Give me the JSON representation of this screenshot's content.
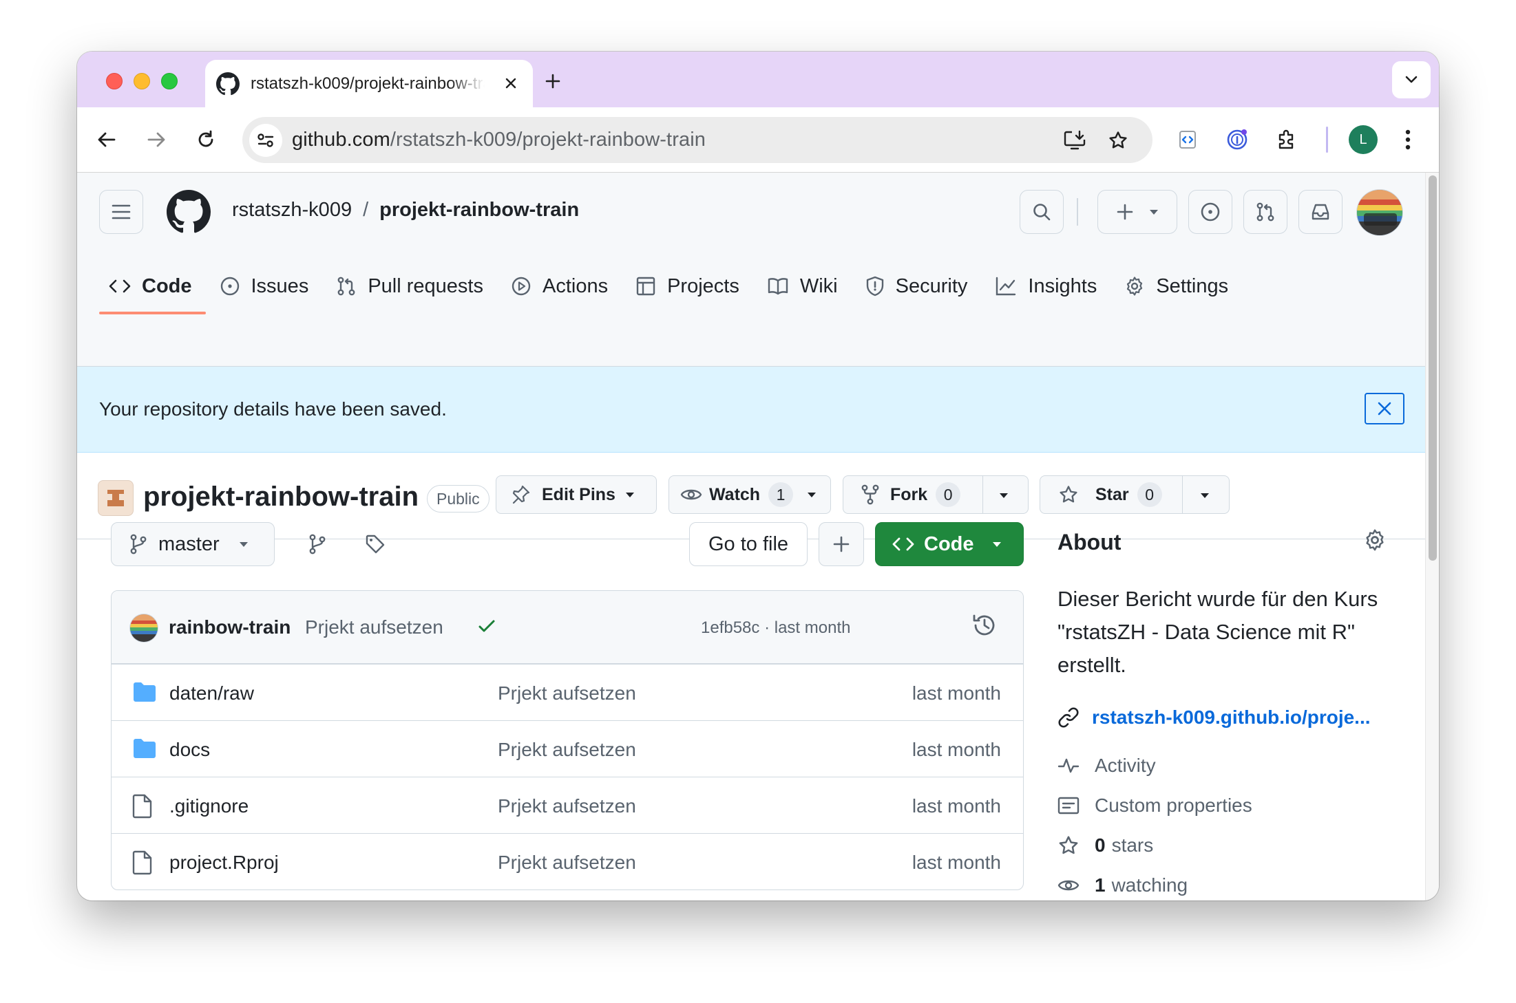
{
  "browser": {
    "tab_title": "rstatszh-k009/projekt-rainbow-train",
    "url_host": "github.com",
    "url_path": "/rstatszh-k009/projekt-rainbow-train",
    "profile_initial": "L"
  },
  "header": {
    "owner": "rstatszh-k009",
    "separator": "/",
    "repo": "projekt-rainbow-train"
  },
  "repo_nav": [
    {
      "label": "Code",
      "icon": "code-icon",
      "active": true
    },
    {
      "label": "Issues",
      "icon": "issue-icon"
    },
    {
      "label": "Pull requests",
      "icon": "pull-request-icon"
    },
    {
      "label": "Actions",
      "icon": "play-icon"
    },
    {
      "label": "Projects",
      "icon": "table-icon"
    },
    {
      "label": "Wiki",
      "icon": "book-icon"
    },
    {
      "label": "Security",
      "icon": "shield-icon"
    },
    {
      "label": "Insights",
      "icon": "graph-icon"
    },
    {
      "label": "Settings",
      "icon": "gear-icon"
    }
  ],
  "flash": {
    "message": "Your repository details have been saved."
  },
  "repo_title": {
    "name": "projekt-rainbow-train",
    "visibility": "Public",
    "edit_pins": "Edit Pins",
    "watch": "Watch",
    "watch_count": "1",
    "fork": "Fork",
    "fork_count": "0",
    "star": "Star",
    "star_count": "0"
  },
  "toolbar": {
    "branch": "master",
    "go_to_file": "Go to file",
    "code": "Code"
  },
  "latest_commit": {
    "author": "rainbow-train",
    "message": "Prjekt aufsetzen",
    "meta": "1efb58c · last month"
  },
  "files": [
    {
      "name": "daten/raw",
      "type": "folder",
      "message": "Prjekt aufsetzen",
      "date": "last month"
    },
    {
      "name": "docs",
      "type": "folder",
      "message": "Prjekt aufsetzen",
      "date": "last month"
    },
    {
      "name": ".gitignore",
      "type": "file",
      "message": "Prjekt aufsetzen",
      "date": "last month"
    },
    {
      "name": "project.Rproj",
      "type": "file",
      "message": "Prjekt aufsetzen",
      "date": "last month"
    }
  ],
  "about": {
    "heading": "About",
    "description": "Dieser Bericht wurde für den Kurs \"rstatsZH - Data Science mit R\" erstellt.",
    "link": "rstatszh-k009.github.io/proje...",
    "activity": "Activity",
    "custom_properties": "Custom properties",
    "stars_count": "0",
    "stars_label": "stars",
    "watching_count": "1",
    "watching_label": "watching"
  },
  "colors": {
    "tabstrip": "#e6d5f8",
    "flash_bg": "#ddf4ff",
    "primary_green": "#1f883d",
    "link_blue": "#0969da",
    "nav_underline": "#fd8c73"
  }
}
